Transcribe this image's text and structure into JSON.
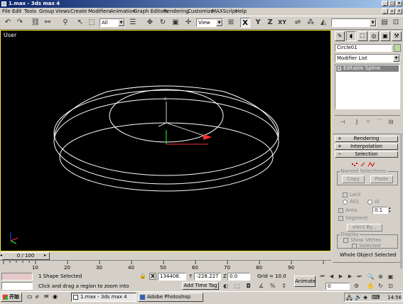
{
  "window": {
    "title": "1.max - 3ds max 4"
  },
  "menu": [
    "File",
    "Edit",
    "Tools",
    "Group",
    "Views",
    "Create",
    "Modifiers",
    "Animation",
    "Graph Editors",
    "Rendering",
    "Customize",
    "MAXScript",
    "Help"
  ],
  "toolbar": {
    "selection_filter": "All",
    "ref_coord": "View",
    "axis_labels": [
      "X",
      "Y",
      "Z",
      "XY"
    ]
  },
  "viewport": {
    "label": "User"
  },
  "command_panel": {
    "object_name": "Circle01",
    "modifier_list": "Modifier List",
    "stack_item": "Editable Spline",
    "rollouts": {
      "rendering": "Rendering",
      "interpolation": "Interpolation",
      "selection": "Selection"
    },
    "named_selections": {
      "title": "Named Selections:",
      "copy": "Copy",
      "paste": "Paste"
    },
    "lock": "Lock",
    "all1": "All1",
    "al": "Al",
    "area": "Area",
    "area_value": "0.1",
    "segment": "Segment",
    "select_by": "elect By...",
    "display": {
      "title": "Display",
      "show_vertex": "Show Vertex",
      "selected": "Selected"
    },
    "status": "Whole Object Selected",
    "colors": {
      "object_swatch": "#b8d8a0",
      "vertex_icon": "#cc0000"
    }
  },
  "time": {
    "slider": "0 / 100",
    "ticks": [
      "10",
      "20",
      "30",
      "40",
      "50",
      "60",
      "70",
      "80",
      "90"
    ]
  },
  "status": {
    "shape_selected": "1 Shape Selected",
    "x_value": "134408.",
    "y_value": "-228.227",
    "z_value": "0.0",
    "grid": "Grid = 10.0",
    "prompt": "Click and drag a region to zoom into",
    "add_time_tag": "Add Time Tag",
    "animate": "Animate",
    "frame": "0"
  },
  "taskbar": {
    "start": "开始",
    "tasks": [
      "1.max - 3ds max 4",
      "Adobe Photoshop"
    ],
    "clock": "14:56"
  }
}
